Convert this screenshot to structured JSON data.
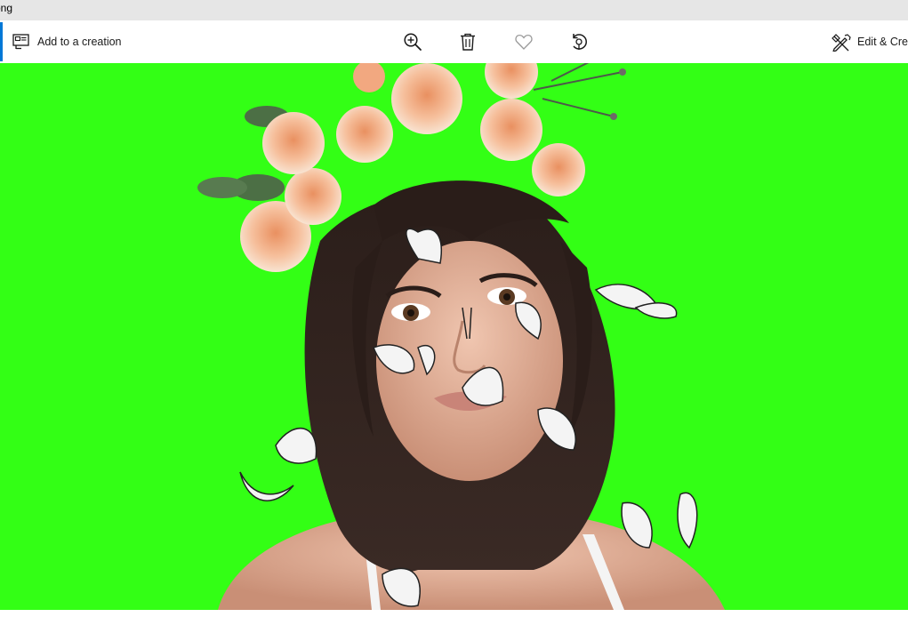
{
  "window": {
    "title": "png"
  },
  "toolbar": {
    "add_to_creation_label": "Add to a creation",
    "edit_create_label": "Edit & Crea",
    "accent_color": "#0078d7",
    "icons": [
      "add-to-creation-icon",
      "zoom-in-icon",
      "delete-icon",
      "favorite-heart-icon",
      "rotate-icon",
      "edit-create-icon"
    ]
  },
  "image": {
    "description_colors": {
      "background": "#33ff15",
      "skin": "#e2b29b",
      "hair": "#2a1d19",
      "flowers": "#f3b18c"
    }
  }
}
